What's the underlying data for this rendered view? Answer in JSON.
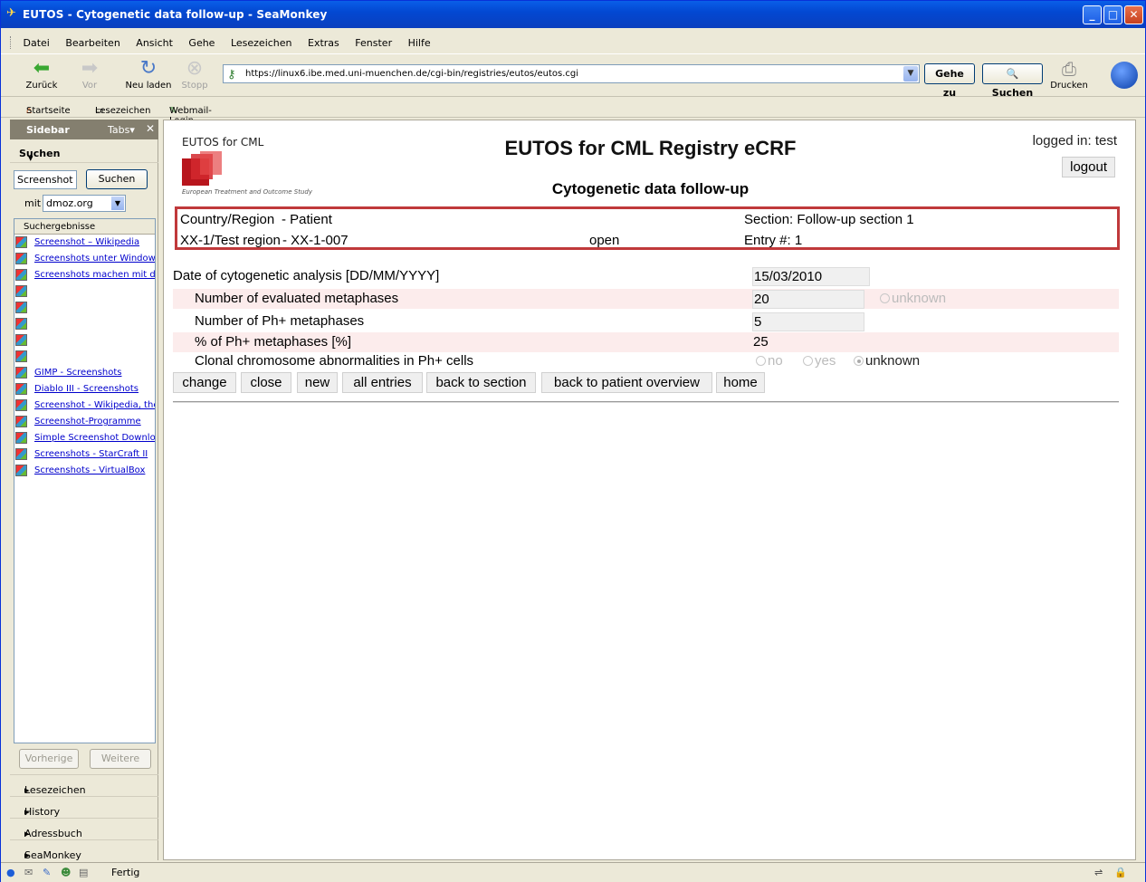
{
  "window": {
    "title": "EUTOS - Cytogenetic data follow-up - SeaMonkey"
  },
  "menu": [
    "Datei",
    "Bearbeiten",
    "Ansicht",
    "Gehe",
    "Lesezeichen",
    "Extras",
    "Fenster",
    "Hilfe"
  ],
  "nav": {
    "back": "Zurück",
    "forward": "Vor",
    "reload": "Neu laden",
    "stop": "Stopp",
    "url": "https://linux6.ibe.med.uni-muenchen.de/cgi-bin/registries/eutos/eutos.cgi",
    "go": "Gehe zu",
    "search": "Suchen",
    "print": "Drucken"
  },
  "bookmarks": [
    "Startseite",
    "Lesezeichen",
    "Webmail-Login MWN"
  ],
  "sidebar": {
    "title": "Sidebar",
    "tabs": "Tabs",
    "section": "Suchen",
    "search_value": "Screenshot",
    "search_button": "Suchen",
    "with_label": "mit",
    "engine": "dmoz.org",
    "results_header": "Suchergebnisse",
    "results": [
      "Screenshot – Wikipedia",
      "Screenshots unter Windows",
      "Screenshots machen mit der",
      "",
      "",
      "",
      "",
      "",
      "GIMP - Screenshots",
      "Diablo III - Screenshots",
      "Screenshot - Wikipedia, the",
      "Screenshot-Programme",
      "Simple Screenshot Download",
      "Screenshots - StarCraft II",
      "Screenshots - VirtualBox"
    ],
    "prev": "Vorherige",
    "next": "Weitere",
    "folds": [
      "Lesezeichen",
      "History",
      "Adressbuch",
      "SeaMonkey deutsch"
    ]
  },
  "page": {
    "logo_text": "EUTOS for CML",
    "logo_sub": "European Treatment and Outcome Study",
    "title": "EUTOS for CML Registry eCRF",
    "subtitle": "Cytogenetic data follow-up",
    "logged": "logged in: test",
    "logout": "logout",
    "info": {
      "country_label": "Country/Region",
      "patient_label": "- Patient",
      "section": "Section: Follow-up section 1",
      "region": "XX-1/Test region",
      "patient": "- XX-1-007",
      "status": "open",
      "entry": "Entry #: 1"
    },
    "fields": {
      "date_label": "Date of cytogenetic analysis [DD/MM/YYYY]",
      "date_value": "15/03/2010",
      "eval_label": "Number of evaluated metaphases",
      "eval_value": "20",
      "eval_unknown": "unknown",
      "ph_label": "Number of Ph+ metaphases",
      "ph_value": "5",
      "pct_label": "% of Ph+ metaphases [%]",
      "pct_value": "25",
      "clonal_label": "Clonal chromosome abnormalities in Ph+ cells",
      "clonal_no": "no",
      "clonal_yes": "yes",
      "clonal_unknown": "unknown"
    },
    "actions": [
      "change",
      "close",
      "new",
      "all entries",
      "back to section",
      "back to patient overview",
      "home"
    ]
  },
  "status": {
    "text": "Fertig"
  },
  "colors": {
    "accent_border": "#c0393b",
    "row_alt": "#fcecec"
  }
}
